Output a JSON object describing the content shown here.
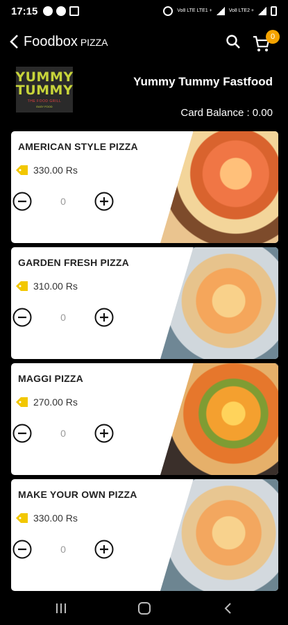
{
  "status_bar": {
    "time": "17:15",
    "lte_text": "Vo8 LTE LTE1 +",
    "lte_text2": "Vo8 LTE2 +"
  },
  "app_bar": {
    "title": "Foodbox",
    "subtitle": "PIZZA",
    "cart_count": "0"
  },
  "store": {
    "name": "Yummy Tummy Fastfood",
    "card_balance": "Card Balance : 0.00",
    "logo": {
      "line1": "YUMMY",
      "line2": "TUMMY",
      "line3": "THE FOOD GRILL",
      "line4": "EASY FOOD"
    }
  },
  "items": [
    {
      "name": "AMERICAN STYLE PIZZA",
      "price": "330.00 Rs",
      "qty": "0"
    },
    {
      "name": "GARDEN FRESH PIZZA",
      "price": "310.00 Rs",
      "qty": "0"
    },
    {
      "name": "MAGGI PIZZA",
      "price": "270.00 Rs",
      "qty": "0"
    },
    {
      "name": "MAKE YOUR OWN PIZZA",
      "price": "330.00 Rs",
      "qty": "0"
    }
  ],
  "colors": {
    "accent": "#f5a300",
    "tag": "#f2c700",
    "logo_text": "#c7d43a"
  }
}
